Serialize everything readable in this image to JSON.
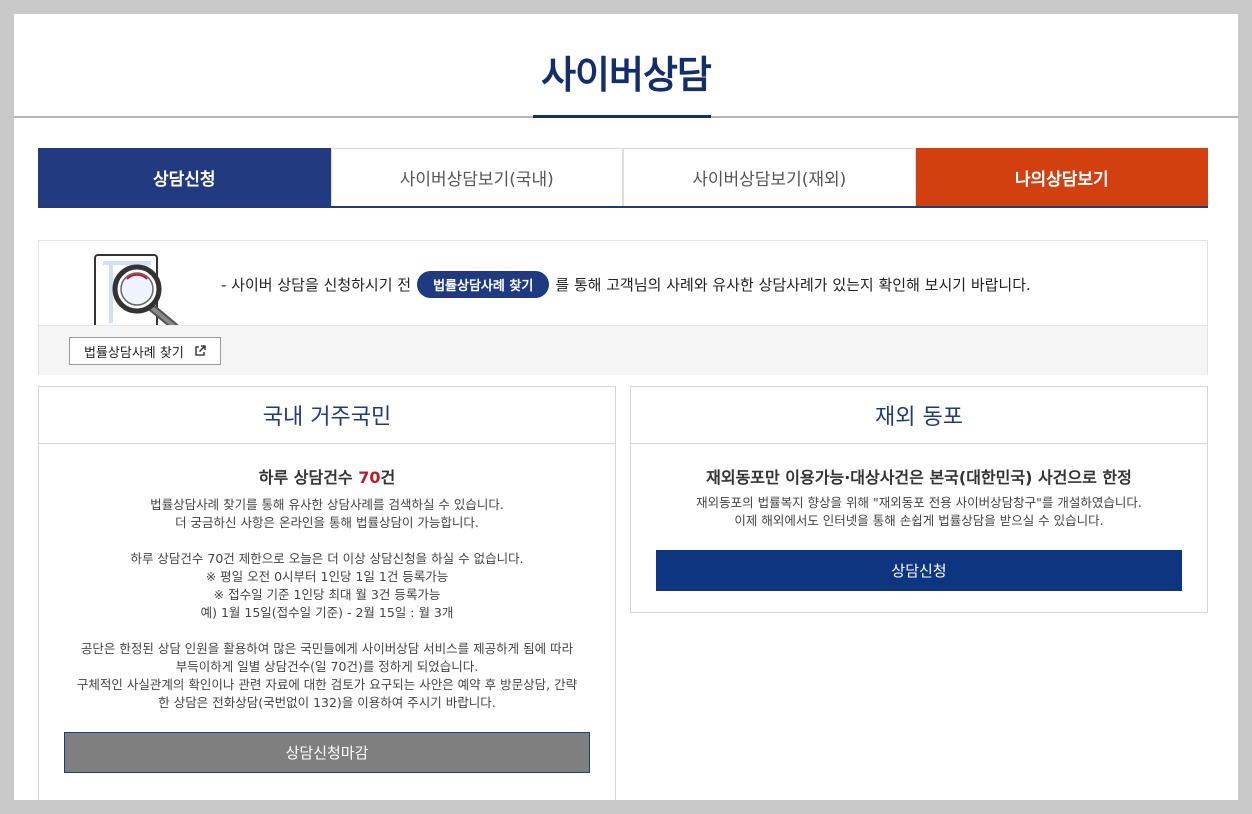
{
  "page": {
    "title": "사이버상담"
  },
  "tabs": [
    {
      "label": "상담신청",
      "state": "active"
    },
    {
      "label": "사이버상담보기(국내)",
      "state": "normal"
    },
    {
      "label": "사이버상담보기(재외)",
      "state": "normal"
    },
    {
      "label": "나의상담보기",
      "state": "highlight"
    }
  ],
  "notice": {
    "prefix": "- 사이버 상담을 신청하시기 전",
    "pill": "법률상담사례 찾기",
    "suffix": "를 통해 고객님의 사례와 유사한 상담사례가 있는지 확인해 보시기 바랍니다.",
    "button": "법률상담사례 찾기",
    "icon": "external-link-icon",
    "illustration": "magnifier-document-icon"
  },
  "domestic": {
    "title": "국내 거주국민",
    "limit_prefix": "하루 상담건수 ",
    "limit_value": "70",
    "limit_suffix": "건",
    "para1": [
      "법률상담사례 찾기를 통해 유사한 상담사례를 검색하실 수 있습니다.",
      "더 궁금하신 사항은 온라인을 통해 법률상담이 가능합니다."
    ],
    "para2": [
      "하루 상담건수 70건 제한으로 오늘은 더 이상 상담신청을 하실 수 없습니다.",
      "※ 평일 오전 0시부터 1인당 1일 1건 등록가능",
      "※ 접수일 기준 1인당 최대 월 3건 등록가능",
      "예) 1월 15일(접수일 기준) - 2월 15일 : 월 3개"
    ],
    "para3": [
      "공단은 한정된 상담 인원을 활용하여 많은 국민들에게 사이버상담 서비스를 제공하게 됨에 따라",
      "부득이하게 일별 상담건수(일 70건)를 정하게 되었습니다.",
      "구체적인 사실관계의 확인이나 관련 자료에 대한 검토가 요구되는 사안은 예약 후 방문상담, 간략",
      "한 상담은 전화상담(국번없이 132)을 이용하여 주시기 바랍니다."
    ],
    "button": "상담신청마감"
  },
  "overseas": {
    "title": "재외 동포",
    "subtitle": "재외동포만 이용가능·대상사건은 본국(대한민국) 사건으로 한정",
    "lines": [
      "재외동포의 법률복지 향상을 위해 \"재외동포 전용 사이버상담창구\"를 개설하였습니다.",
      "이제 해외에서도 인터넷을 통해 손쉽게 법률상담을 받으실 수 있습니다."
    ],
    "button": "상담신청"
  },
  "colors": {
    "navy": "#223a80",
    "orange": "#d3400f",
    "closed": "#7f7f7f",
    "red": "#c0182c"
  }
}
